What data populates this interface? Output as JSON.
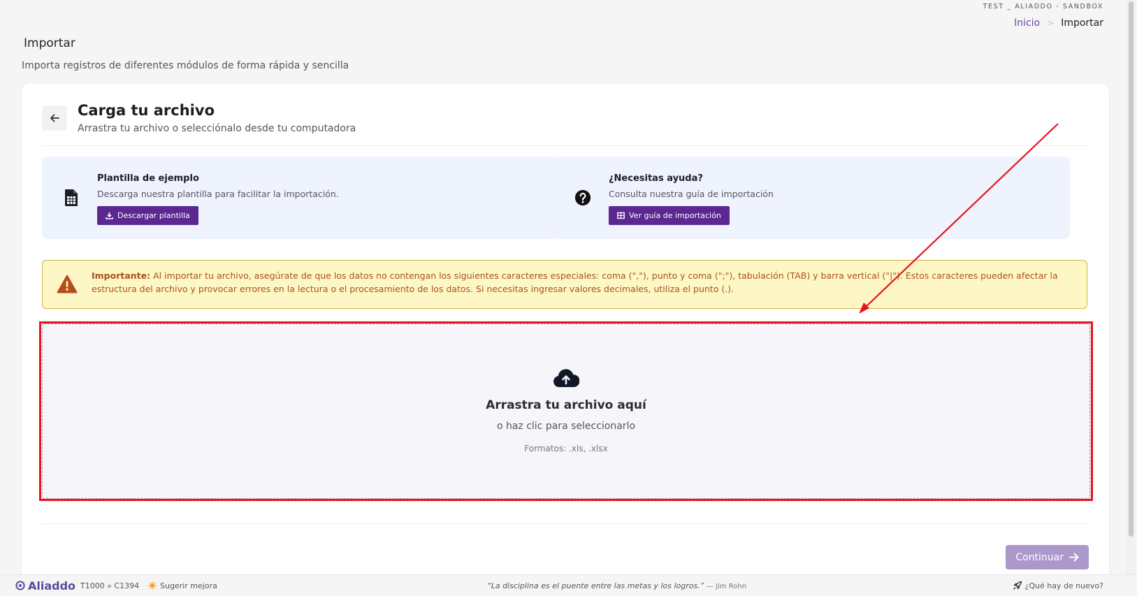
{
  "header": {
    "env_label": "TEST _ ALIADDO - SANDBOX",
    "breadcrumb": {
      "home": "Inicio",
      "separator": ">",
      "current": "Importar"
    },
    "title": "Importar",
    "subtitle": "Importa registros de diferentes módulos de forma rápida y sencilla"
  },
  "card": {
    "back_icon": "arrow-left-icon",
    "title": "Carga tu archivo",
    "subtitle": "Arrastra tu archivo o selecciónalo desde tu computadora",
    "template_box": {
      "icon": "spreadsheet-file-icon",
      "title": "Plantilla de ejemplo",
      "description": "Descarga nuestra plantilla para facilitar la importación.",
      "button_label": "Descargar plantilla",
      "button_icon": "download-icon"
    },
    "help_box": {
      "icon": "question-circle-icon",
      "title": "¿Necesitas ayuda?",
      "description": "Consulta nuestra guía de importación",
      "button_label": "Ver guía de importación",
      "button_icon": "table-icon"
    },
    "warning": {
      "icon": "warning-triangle-icon",
      "label": "Importante:",
      "text": " Al importar tu archivo, asegúrate de que los datos no contengan los siguientes caracteres especiales: coma (\",\"), punto y coma (\";\"), tabulación (TAB) y barra vertical (\"|\"). Estos caracteres pueden afectar la estructura del archivo y provocar errores en la lectura o el procesamiento de los datos. Si necesitas ingresar valores decimales, utiliza el punto (.)."
    },
    "dropzone": {
      "icon": "cloud-upload-icon",
      "title": "Arrastra tu archivo aquí",
      "subtitle": "o haz clic para seleccionarlo",
      "formats": "Formatos: .xls, .xlsx"
    },
    "continue_label": "Continuar"
  },
  "footer": {
    "brand": "Aliaddo",
    "tenant": "T1000 » C1394",
    "suggest": "Sugerir mejora",
    "quote": "“La disciplina es el puente entre las metas y los logros.”",
    "quote_author": "— Jim Rohn",
    "whats_new": "¿Qué hay de nuevo?"
  },
  "colors": {
    "accent": "#5b2790",
    "continue_disabled": "#ad98cc",
    "info_bg": "#eef3fd",
    "warning_bg": "#fdf7c6",
    "warning_text": "#a8531a",
    "annotation_red": "#e8131b"
  }
}
